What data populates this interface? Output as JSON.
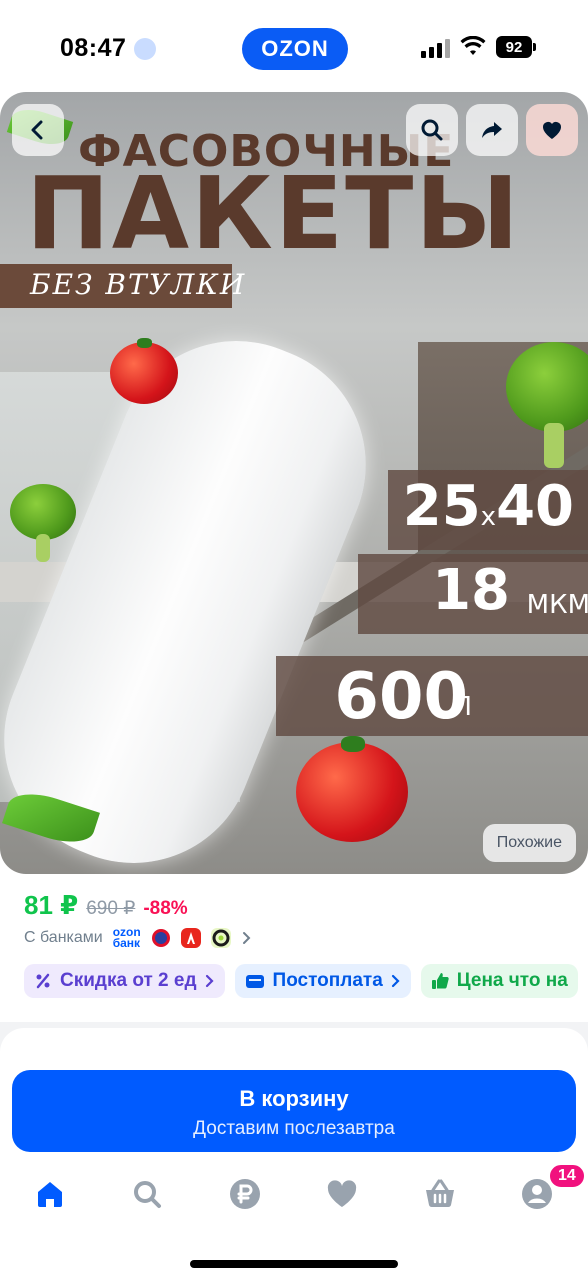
{
  "status_bar": {
    "time": "08:47",
    "brand": "OZON",
    "battery": "92"
  },
  "hero": {
    "title_line1": "ФАСОВОЧНЫЕ",
    "title_line2": "ПАКЕТЫ",
    "subtitle": "БЕЗ ВТУЛКИ",
    "specs": [
      {
        "value": "25",
        "separator": "x",
        "value2": "40",
        "unit": ""
      },
      {
        "value": "18",
        "unit": "МКМ"
      },
      {
        "value": "600",
        "unit": "Л"
      }
    ],
    "similar_label": "Похожие",
    "icons": {
      "back": "back-icon",
      "search": "search-icon",
      "share": "share-icon",
      "favorite": "heart-icon"
    }
  },
  "pricing": {
    "price": "81 ₽",
    "old_price": "690 ₽",
    "discount": "-88%"
  },
  "banks": {
    "label": "С банками",
    "ozon_bank_line1": "ozon",
    "ozon_bank_line2": "банк"
  },
  "chips": [
    {
      "label": "Скидка от 2 ед",
      "icon": "percent-icon"
    },
    {
      "label": "Постоплата",
      "icon": "wallet-icon"
    },
    {
      "label": "Цена что на",
      "icon": "thumbs-up-icon"
    }
  ],
  "cart_button": {
    "title": "В корзину",
    "subtitle": "Доставим послезавтра"
  },
  "tabbar": {
    "cart_badge": "14"
  },
  "colors": {
    "accent": "#005bff",
    "price": "#10c44c",
    "discount": "#f91155",
    "badge": "#f1117e"
  }
}
